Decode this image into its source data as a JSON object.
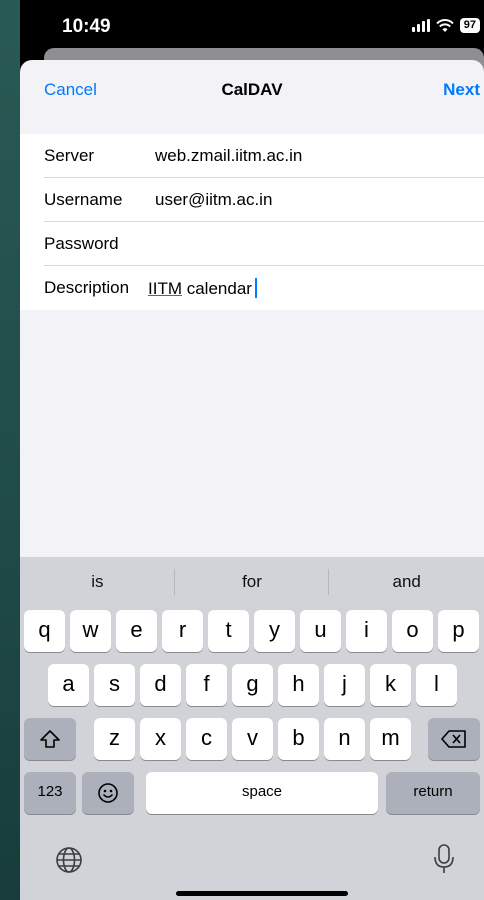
{
  "status": {
    "time": "10:49",
    "battery": "97"
  },
  "nav": {
    "cancel": "Cancel",
    "title": "CalDAV",
    "next": "Next"
  },
  "form": {
    "server_label": "Server",
    "server_value": "web.zmail.iitm.ac.in",
    "username_label": "Username",
    "username_value": "user@iitm.ac.in",
    "password_label": "Password",
    "password_value": "",
    "description_label": "Description",
    "description_word1": "IITM",
    "description_word2": " calendar"
  },
  "keyboard": {
    "suggestions": [
      "is",
      "for",
      "and"
    ],
    "row1": [
      "q",
      "w",
      "e",
      "r",
      "t",
      "y",
      "u",
      "i",
      "o",
      "p"
    ],
    "row2": [
      "a",
      "s",
      "d",
      "f",
      "g",
      "h",
      "j",
      "k",
      "l"
    ],
    "row3": [
      "z",
      "x",
      "c",
      "v",
      "b",
      "n",
      "m"
    ],
    "numbers": "123",
    "space": "space",
    "return": "return"
  },
  "colors": {
    "accent": "#007aff",
    "sheet_bg": "#f2f2f7",
    "keyboard_bg": "#d1d3d9"
  }
}
